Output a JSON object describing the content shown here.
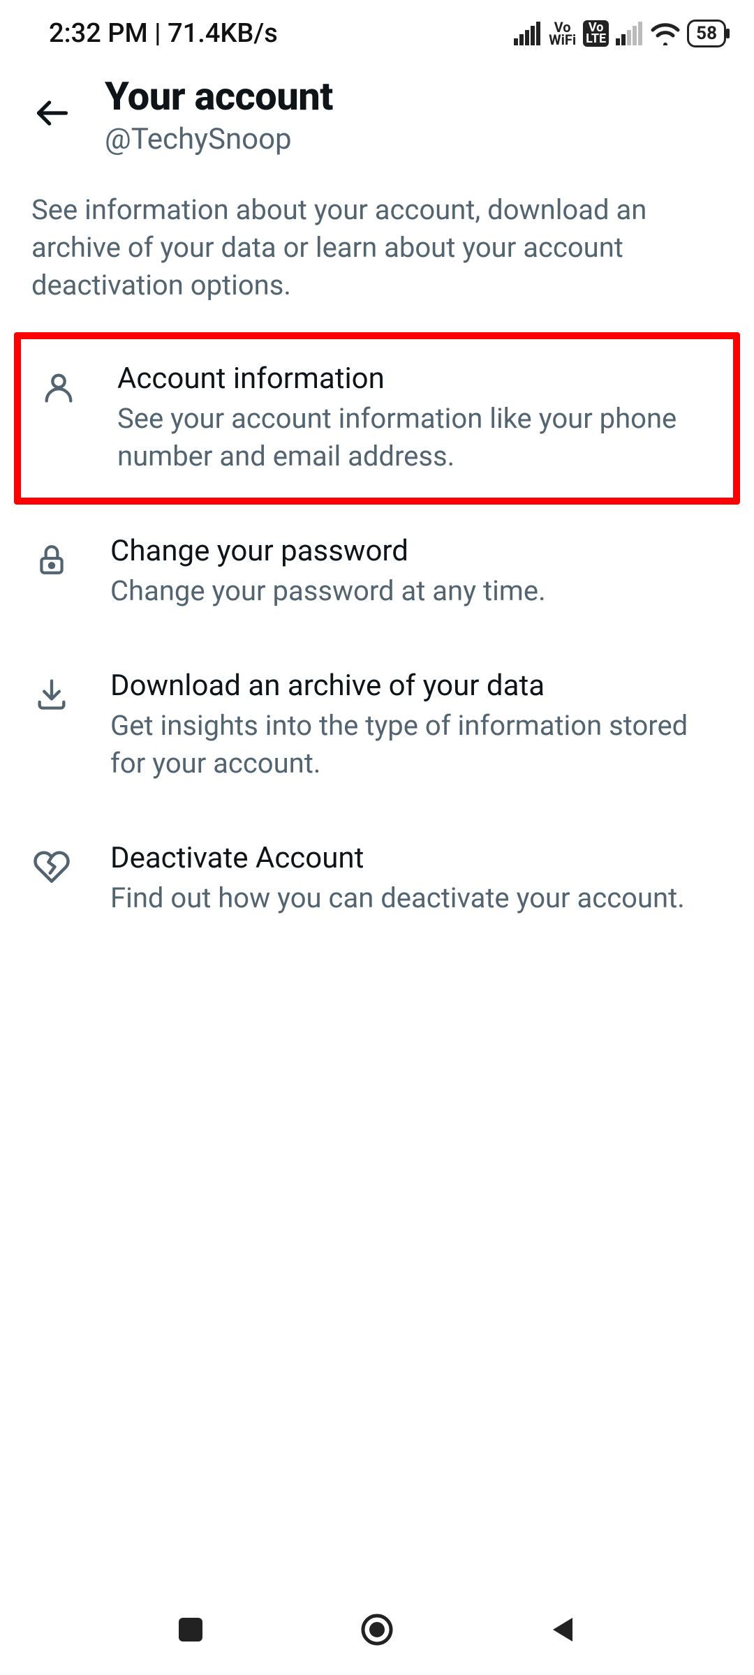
{
  "statusbar": {
    "time": "2:32 PM | 71.4KB/s",
    "battery": "58",
    "vo_line1": "Vo",
    "vo_line2": "WiFi",
    "lte_line1": "Vo",
    "lte_line2": "LTE"
  },
  "header": {
    "title": "Your account",
    "subtitle": "@TechySnoop"
  },
  "description": "See information about your account, download an archive of your data or learn about your account deactivation options.",
  "items": [
    {
      "title": "Account information",
      "desc": "See your account information like your phone number and email address."
    },
    {
      "title": "Change your password",
      "desc": "Change your password at any time."
    },
    {
      "title": "Download an archive of your data",
      "desc": "Get insights into the type of information stored for your account."
    },
    {
      "title": "Deactivate Account",
      "desc": "Find out how you can deactivate your account."
    }
  ]
}
